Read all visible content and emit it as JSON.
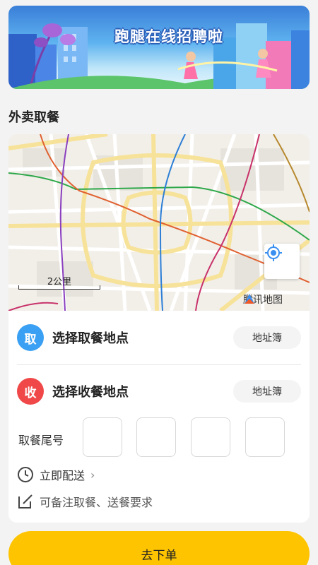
{
  "banner": {
    "title": "跑腿在线招聘啦"
  },
  "section": {
    "title": "外卖取餐"
  },
  "map": {
    "scale_label": "2公里",
    "provider": "腾讯地图"
  },
  "pickup": {
    "badge": "取",
    "label": "选择取餐地点",
    "address_book": "地址簿",
    "badge_color": "#3aa0f3"
  },
  "dropoff": {
    "badge": "收",
    "label": "选择收餐地点",
    "address_book": "地址簿",
    "badge_color": "#f04848"
  },
  "tail": {
    "label": "取餐尾号",
    "values": [
      "",
      "",
      "",
      ""
    ]
  },
  "delivery": {
    "label": "立即配送"
  },
  "note": {
    "placeholder": "可备注取餐、送餐要求"
  },
  "submit": {
    "label": "去下单",
    "color": "#ffc400"
  }
}
